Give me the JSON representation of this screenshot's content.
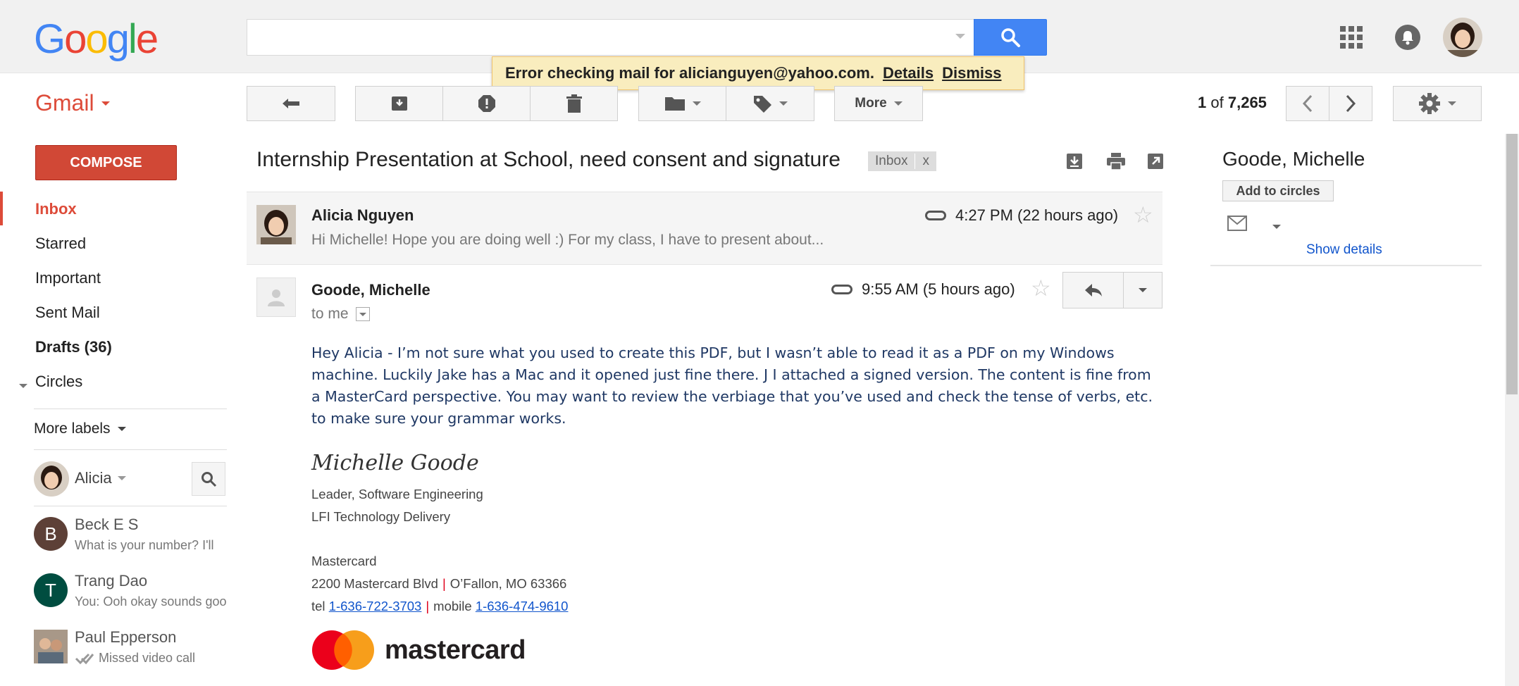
{
  "header": {
    "logo_letters": [
      {
        "ch": "G",
        "color": "#4285f4"
      },
      {
        "ch": "o",
        "color": "#ea4335"
      },
      {
        "ch": "o",
        "color": "#fbbc05"
      },
      {
        "ch": "g",
        "color": "#4285f4"
      },
      {
        "ch": "l",
        "color": "#34a853"
      },
      {
        "ch": "e",
        "color": "#ea4335"
      }
    ],
    "search_placeholder": "",
    "icons": [
      "search-icon",
      "apps-grid-icon",
      "notifications-bell-icon",
      "account-avatar"
    ]
  },
  "toast": {
    "message": "Error checking mail for alicianguyen@yahoo.com.",
    "details": "Details",
    "dismiss": "Dismiss"
  },
  "app": {
    "label": "Gmail",
    "accent": "#dd4b39"
  },
  "toolbar": {
    "more_label": "More",
    "pager_current": "1",
    "pager_of": "of",
    "pager_total": "7,265"
  },
  "sidebar": {
    "compose_label": "COMPOSE",
    "items": [
      {
        "label": "Inbox"
      },
      {
        "label": "Starred"
      },
      {
        "label": "Important"
      },
      {
        "label": "Sent Mail"
      },
      {
        "label": "Drafts (36)"
      },
      {
        "label": "Circles"
      }
    ],
    "more_labels": "More labels",
    "chat_user": "Alicia",
    "chats": [
      {
        "name": "Beck E S",
        "message": "What is your number? I'll",
        "initial": "B",
        "color": "#5d4037"
      },
      {
        "name": "Trang Dao",
        "message": "You: Ooh okay sounds good",
        "initial": "T",
        "color": "#004d40"
      },
      {
        "name": "Paul Epperson",
        "message": "Missed video call",
        "initial": "",
        "color": "#7a6a5a"
      }
    ]
  },
  "thread": {
    "subject": "Internship Presentation at School, need consent and signature",
    "tag_label": "Inbox",
    "tag_close": "x",
    "messages": [
      {
        "sender": "Alicia Nguyen",
        "time": "4:27 PM (22 hours ago)",
        "snippet": "Hi Michelle! Hope you are doing well :) For my class, I have to present about..."
      },
      {
        "sender": "Goode, Michelle",
        "time": "9:55 AM (5 hours ago)",
        "to": "to me",
        "body": "Hey Alicia - I’m not sure what you used to create this PDF, but I wasn’t able to read it as a PDF on my Windows machine.  Luckily Jake has a Mac and it opened just fine there.  J  I attached a signed version.  The content is fine from a MasterCard perspective.  You may want to review the verbiage that you’ve used and check the tense of verbs, etc. to make sure your grammar works.",
        "signature": {
          "name": "Michelle Goode",
          "title": "Leader, Software Engineering",
          "dept": "LFI Technology Delivery",
          "company": "Mastercard",
          "address1": "2200 Mastercard Blvd",
          "address2": "O’Fallon, MO 63366",
          "tel_label": "tel",
          "tel": "1-636-722-3703",
          "mobile_label": "mobile",
          "mobile": "1-636-474-9610",
          "logo_text": "mastercard"
        }
      }
    ]
  },
  "right_panel": {
    "name": "Goode, Michelle",
    "add_to_circles": "Add to circles",
    "show_details": "Show details"
  }
}
